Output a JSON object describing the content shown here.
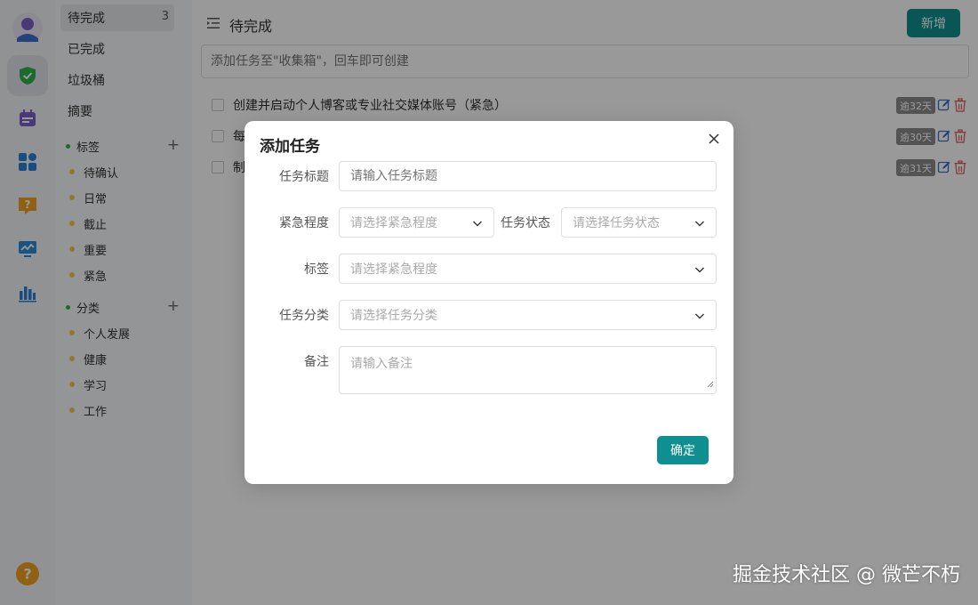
{
  "rail": {
    "icons": [
      "avatar-icon",
      "check-shield-icon",
      "calendar-icon",
      "apps-grid-icon",
      "question-chat-icon",
      "monitor-chart-icon",
      "bar-chart-icon"
    ],
    "help_glyph": "?",
    "colors": {
      "avatar": "#7b5fc7",
      "check": "#2fb34b",
      "calendar": "#7b5fc7",
      "apps": "#2a7fd6",
      "question": "#f0a020",
      "monitor": "#2a8ad6",
      "bars": "#2a7fd6",
      "help": "#f0a020"
    }
  },
  "sidebar": {
    "nav": [
      {
        "label": "待完成",
        "count": "3"
      },
      {
        "label": "已完成"
      },
      {
        "label": "垃圾桶"
      },
      {
        "label": "摘要"
      }
    ],
    "tags": {
      "title": "标签",
      "plus": "+",
      "items": [
        "待确认",
        "日常",
        "截止",
        "重要",
        "紧急"
      ]
    },
    "categories": {
      "title": "分类",
      "plus": "+",
      "items": [
        "个人发展",
        "健康",
        "学习",
        "工作"
      ]
    }
  },
  "main": {
    "title": "待完成",
    "add_button": "新增",
    "quick_input_placeholder": "添加任务至\"收集箱\"，回车即可创建",
    "tasks": [
      {
        "title": "创建并启动个人博客或专业社交媒体账号（紧急）",
        "badge": "逾32天"
      },
      {
        "title": "每",
        "badge": "逾30天"
      },
      {
        "title": "制",
        "badge": "逾31天"
      }
    ]
  },
  "modal": {
    "title": "添加任务",
    "fields": {
      "title": {
        "label": "任务标题",
        "placeholder": "请输入任务标题"
      },
      "urgency": {
        "label": "紧急程度",
        "placeholder": "请选择紧急程度"
      },
      "status": {
        "label": "任务状态",
        "placeholder": "请选择任务状态"
      },
      "tags": {
        "label": "标签",
        "placeholder": "请选择紧急程度"
      },
      "category": {
        "label": "任务分类",
        "placeholder": "请选择任务分类"
      },
      "note": {
        "label": "备注",
        "placeholder": "请输入备注"
      }
    },
    "confirm": "确定"
  },
  "watermark": "掘金技术社区 @ 微芒不朽",
  "accent_color": "#0f8f8f"
}
